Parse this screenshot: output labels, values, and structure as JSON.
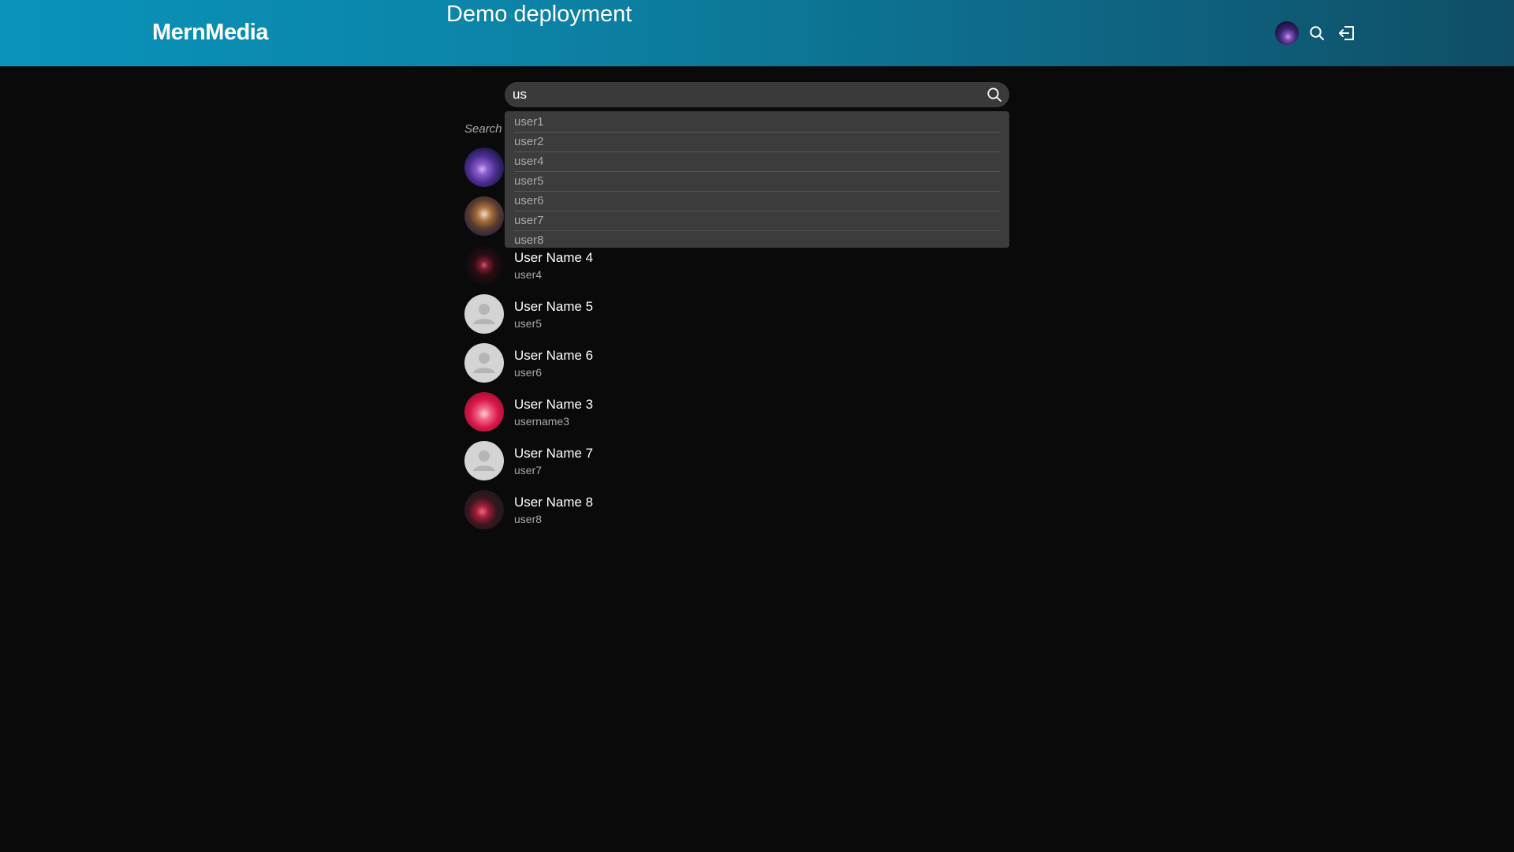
{
  "header": {
    "brand": "MernMedia",
    "banner_title": "Demo deployment",
    "icons": {
      "avatar": "user-avatar",
      "search": "search-icon",
      "logout": "logout-icon"
    }
  },
  "search": {
    "value": "us",
    "placeholder": "",
    "submit_icon": "search-icon",
    "label": "Search",
    "suggestions": [
      "user1",
      "user2",
      "user4",
      "user5",
      "user6",
      "user7",
      "user8"
    ]
  },
  "results": [
    {
      "name": "",
      "handle": "",
      "avatar": "photo"
    },
    {
      "name": "",
      "handle": "",
      "avatar": "photo"
    },
    {
      "name": "User Name 4",
      "handle": "user4",
      "avatar": "photo"
    },
    {
      "name": "User Name 5",
      "handle": "user5",
      "avatar": "default-person-icon"
    },
    {
      "name": "User Name 6",
      "handle": "user6",
      "avatar": "default-person-icon"
    },
    {
      "name": "User Name 3",
      "handle": "username3",
      "avatar": "photo"
    },
    {
      "name": "User Name 7",
      "handle": "user7",
      "avatar": "default-person-icon"
    },
    {
      "name": "User Name 8",
      "handle": "user8",
      "avatar": "photo"
    }
  ],
  "colors": {
    "header_gradient_start": "#0993bb",
    "header_gradient_end": "#0f4e66",
    "background": "#0a0a0a",
    "search_bg": "#3a3a3a",
    "suggestion_bg": "#3c3c3c",
    "muted_text": "#a9a9a9"
  }
}
